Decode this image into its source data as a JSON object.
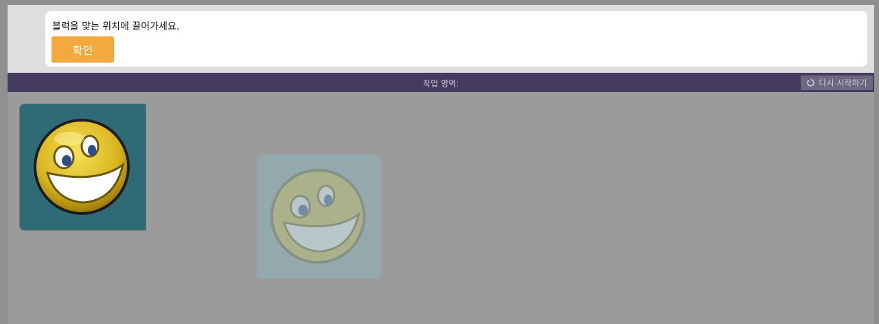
{
  "instruction": {
    "text": "블럭을 맞는 위치에 끌어가세요.",
    "confirm_label": "확인"
  },
  "workspace": {
    "label": "작업 영역:",
    "restart_label": "다시 시작하기",
    "restart_icon": "refresh-icon"
  },
  "blocks": {
    "draggable_icon": "smiley-face-icon",
    "target_icon": "smiley-face-icon"
  },
  "colors": {
    "confirm": "#f4a93e",
    "workspace_bar": "#443b5e",
    "block_background": "#2e6b76",
    "target_background": "#93a9ad"
  }
}
